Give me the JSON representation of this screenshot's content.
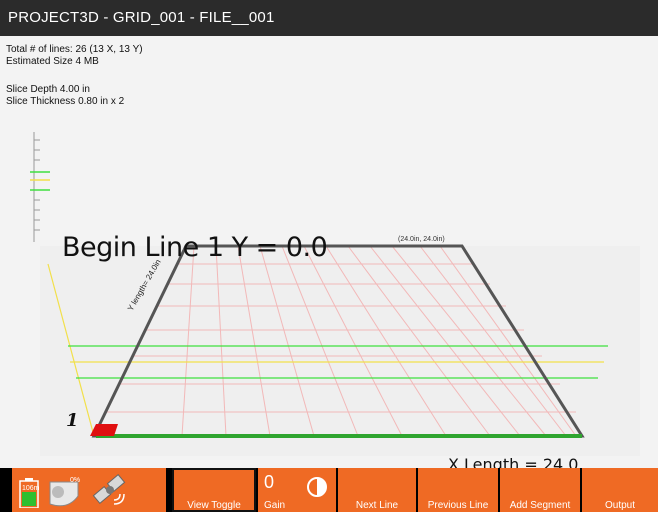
{
  "app": {
    "title": "PROJECT3D - GRID_001 - FILE__001"
  },
  "info": {
    "total_lines": "Total # of lines: 26 (13 X, 13 Y)",
    "estimated_size": "Estimated Size 4 MB",
    "slice_depth": "Slice Depth 4.00 in",
    "slice_thickness": "Slice Thickness 0.80 in x 2"
  },
  "scene": {
    "begin_line": "Begin Line 1   Y = 0.0",
    "corner": "(24.0in, 24.0in)",
    "y_length": "Y length= 24.0in",
    "line_number": "1",
    "x_length": "X Length = 24.0"
  },
  "status": {
    "battery_value": "106m",
    "disk_percent": "0%",
    "battery_icon": "battery-icon",
    "disk_icon": "hard-drive-icon",
    "satellite_icon": "satellite-icon"
  },
  "toolbar": {
    "view_toggle": "View Toggle",
    "gain_value": "0",
    "gain_label": "Gain",
    "gain_icon": "contrast-icon",
    "next_line": "Next Line",
    "previous_line": "Previous Line",
    "add_segment": "Add Segment",
    "output": "Output"
  },
  "colors": {
    "accent": "#ef6a24",
    "title_bar": "#2b2b2b",
    "grid_line": "#f2b8b8",
    "green_line": "#3fe03f",
    "yellow_line": "#f2e04a"
  }
}
